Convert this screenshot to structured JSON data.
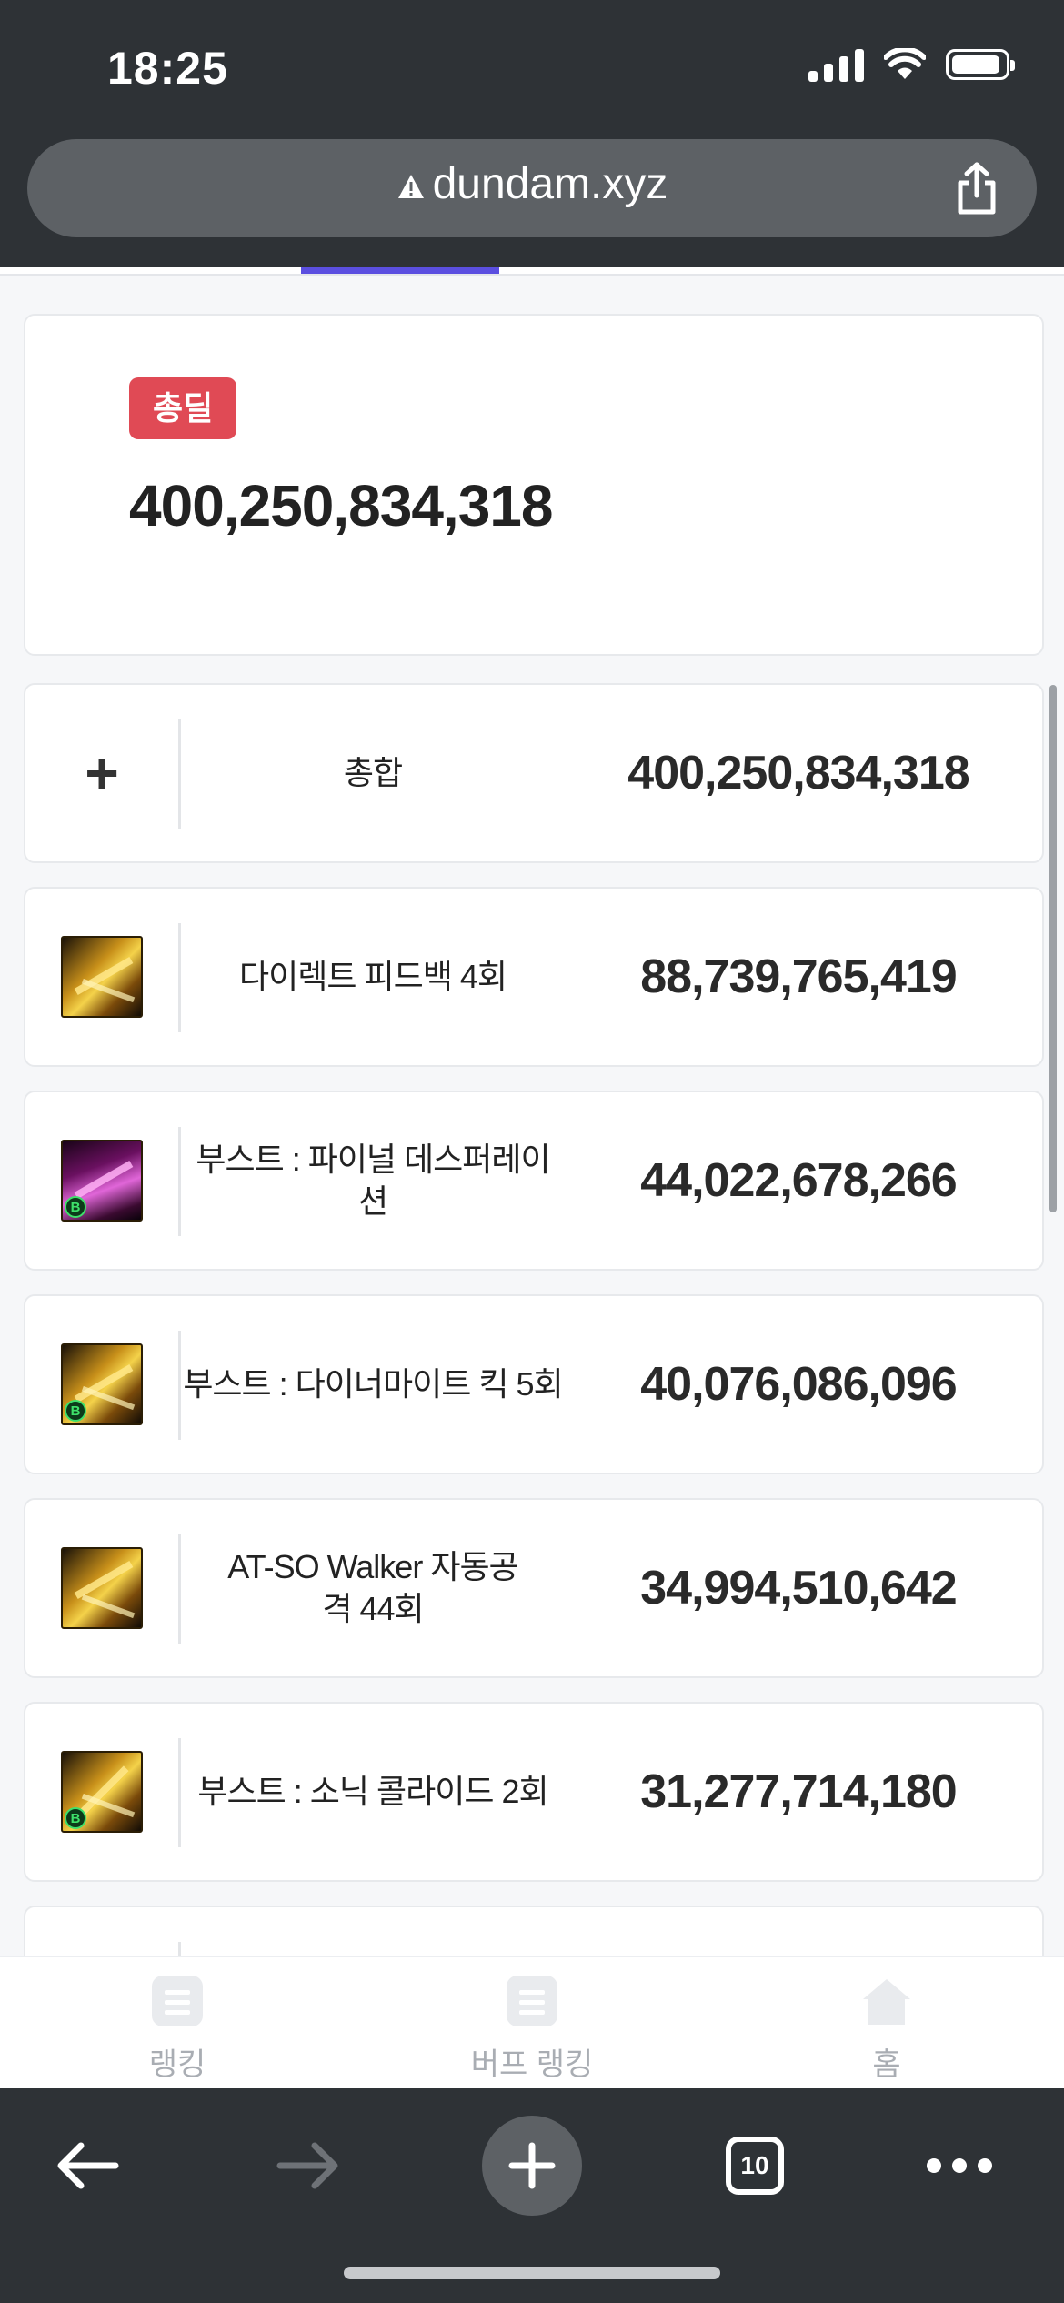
{
  "status_bar": {
    "time": "18:25"
  },
  "url_bar": {
    "domain": "dundam.xyz"
  },
  "total_card": {
    "badge": "총딜",
    "value": "400,250,834,318"
  },
  "summary_row": {
    "name": "총합",
    "value": "400,250,834,318"
  },
  "skill_rows": [
    {
      "name": "다이렉트 피드백 4회",
      "value": "88,739,765,419",
      "icon": "direct-feedback-skill-icon",
      "boost": false
    },
    {
      "name": "부스트 : 파이널 데스퍼레이션",
      "value": "44,022,678,266",
      "icon": "final-desperation-skill-icon",
      "boost": true
    },
    {
      "name": "부스트 : 다이너마이트 킥 5회",
      "value": "40,076,086,096",
      "icon": "dynamite-kick-skill-icon",
      "boost": true
    },
    {
      "name": "AT-SO Walker 자동공격 44회",
      "value": "34,994,510,642",
      "icon": "at-so-walker-skill-icon",
      "boost": false
    },
    {
      "name": "부스트 : 소닉 콜라이드 2회",
      "value": "31,277,714,180",
      "icon": "sonic-collide-skill-icon",
      "boost": true
    }
  ],
  "boost_badge_letter": "B",
  "page_nav": {
    "ranking": "랭킹",
    "buff_ranking": "버프 랭킹",
    "home": "홈"
  },
  "browser_toolbar": {
    "tab_count": "10"
  },
  "colors": {
    "badge": "#e04a55",
    "tab_indicator": "#5b4fe0",
    "chrome": "#2e3236"
  }
}
